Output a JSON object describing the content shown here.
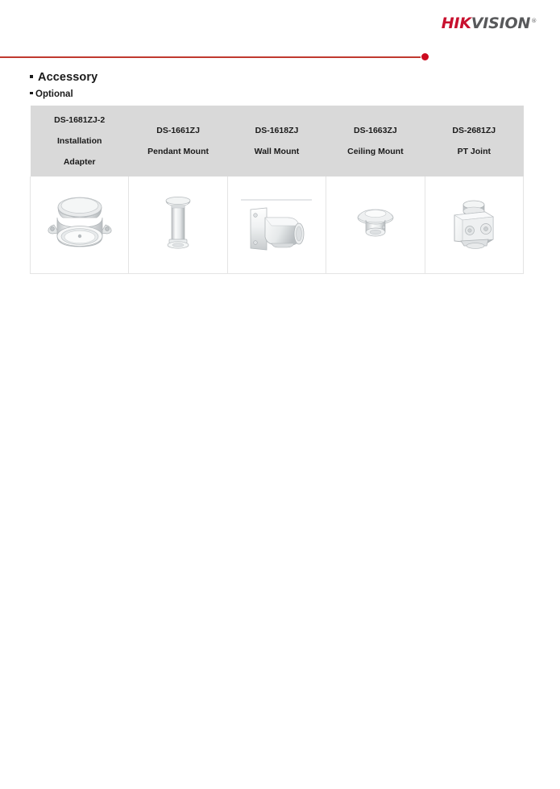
{
  "brand": {
    "logo_hik": "HIK",
    "logo_vision": "VISION",
    "logo_registered": "®"
  },
  "headings": {
    "accessory": "Accessory",
    "optional": "Optional"
  },
  "colors": {
    "brand_red": "#c8102e",
    "rule_red": "#c0392f",
    "dot_red": "#cc0b20",
    "logo_gray": "#58595b",
    "header_gray": "#d9d9d9",
    "cell_border": "#e4e4e4",
    "text": "#1a1a1a"
  },
  "accessory_table": {
    "columns": [
      {
        "model": "DS-1681ZJ-2",
        "name_line1": "Installation",
        "name_line2": "Adapter",
        "icon": "installation-adapter-icon"
      },
      {
        "model": "DS-1661ZJ",
        "name_line1": "Pendant Mount",
        "name_line2": "",
        "icon": "pendant-mount-icon"
      },
      {
        "model": "DS-1618ZJ",
        "name_line1": "Wall Mount",
        "name_line2": "",
        "icon": "wall-mount-icon"
      },
      {
        "model": "DS-1663ZJ",
        "name_line1": "Ceiling Mount",
        "name_line2": "",
        "icon": "ceiling-mount-icon"
      },
      {
        "model": "DS-2681ZJ",
        "name_line1": "PT Joint",
        "name_line2": "",
        "icon": "pt-joint-icon"
      }
    ]
  }
}
